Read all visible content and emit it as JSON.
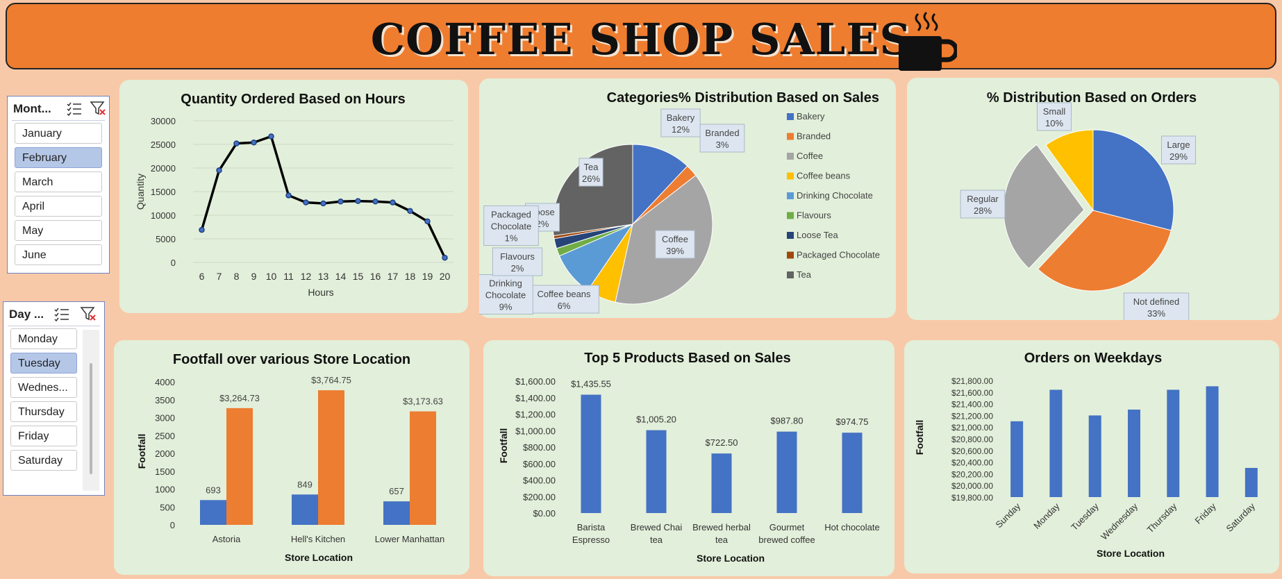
{
  "header": {
    "title": "COFFEE SHOP SALES"
  },
  "slicers": {
    "month": {
      "title": "Mont...",
      "items": [
        "January",
        "February",
        "March",
        "April",
        "May",
        "June"
      ],
      "selected": "February"
    },
    "day": {
      "title": "Day ...",
      "items": [
        "Monday",
        "Tuesday",
        "Wednes...",
        "Thursday",
        "Friday",
        "Saturday"
      ],
      "selected": "Tuesday"
    }
  },
  "chart_data": [
    {
      "type": "line",
      "title": "Quantity Ordered Based on Hours",
      "xlabel": "Hours",
      "ylabel": "Quantity",
      "x": [
        6,
        7,
        8,
        9,
        10,
        11,
        12,
        13,
        14,
        15,
        16,
        17,
        18,
        19,
        20
      ],
      "values": [
        6900,
        19500,
        25200,
        25400,
        26700,
        14200,
        12700,
        12500,
        12900,
        13000,
        12900,
        12700,
        10900,
        8700,
        1000
      ],
      "yticks": [
        0,
        5000,
        10000,
        15000,
        20000,
        25000,
        30000
      ],
      "ylim": [
        0,
        30000
      ],
      "color": "#000000",
      "grid": true
    },
    {
      "type": "pie",
      "title": "Categories%  Distribution Based on Sales",
      "slices": [
        {
          "name": "Bakery",
          "value": 12,
          "color": "#4472c4",
          "label": "12%"
        },
        {
          "name": "Branded",
          "value": 2.5,
          "color": "#ed7d31",
          "label": "3%"
        },
        {
          "name": "Coffee",
          "value": 39,
          "color": "#a5a5a5",
          "label": "39%"
        },
        {
          "name": "Coffee beans",
          "value": 6,
          "color": "#ffc000",
          "label": "6%"
        },
        {
          "name": "Drinking Chocolate",
          "value": 9,
          "color": "#5b9bd5",
          "label": "9%"
        },
        {
          "name": "Flavours",
          "value": 1.6,
          "color": "#70ad47",
          "label": "2%"
        },
        {
          "name": "Loose Tea",
          "value": 2,
          "color": "#264478",
          "label": "2%"
        },
        {
          "name": "Packaged Chocolate",
          "value": 0.6,
          "color": "#9e480e",
          "label": "1%"
        },
        {
          "name": "Tea",
          "value": 27.3,
          "color": "#636363",
          "label": "26%"
        }
      ],
      "legend": "right"
    },
    {
      "type": "pie",
      "title": "% Distribution Based on Orders",
      "slices": [
        {
          "name": "Large",
          "value": 29,
          "color": "#4472c4",
          "label": "29%"
        },
        {
          "name": "Not defined",
          "value": 33,
          "color": "#ed7d31",
          "label": "33%"
        },
        {
          "name": "Regular",
          "value": 28,
          "color": "#a5a5a5",
          "label": "28%"
        },
        {
          "name": "Small",
          "value": 10,
          "color": "#ffc000",
          "label": "10%"
        }
      ]
    },
    {
      "type": "bar",
      "title": "Footfall over various Store Location",
      "xlabel": "Store Location",
      "ylabel": "Footfall",
      "categories": [
        "Astoria",
        "Hell's Kitchen",
        "Lower Manhattan"
      ],
      "series": [
        {
          "values": [
            693,
            849,
            657
          ],
          "color": "#4472c4",
          "labels": [
            "693",
            "849",
            "657"
          ]
        },
        {
          "values": [
            3264.73,
            3764.75,
            3173.63
          ],
          "color": "#ed7d31",
          "labels": [
            "$3,264.73",
            "$3,764.75",
            "$3,173.63"
          ]
        }
      ],
      "yticks": [
        0,
        500,
        1000,
        1500,
        2000,
        2500,
        3000,
        3500,
        4000
      ],
      "ylim": [
        0,
        4000
      ]
    },
    {
      "type": "bar",
      "title": "Top 5 Products Based on Sales",
      "xlabel": "Store Location",
      "ylabel": "Footfall",
      "categories": [
        [
          "Barista",
          "Espresso"
        ],
        [
          "Brewed Chai",
          "tea"
        ],
        [
          "Brewed herbal",
          "tea"
        ],
        [
          "Gourmet",
          "brewed coffee"
        ],
        [
          "Hot chocolate"
        ]
      ],
      "values": [
        1435.55,
        1005.2,
        722.5,
        987.8,
        974.75
      ],
      "labels": [
        "$1,435.55",
        "$1,005.20",
        "$722.50",
        "$987.80",
        "$974.75"
      ],
      "ytick_labels": [
        "$0.00",
        "$200.00",
        "$400.00",
        "$600.00",
        "$800.00",
        "$1,000.00",
        "$1,200.00",
        "$1,400.00",
        "$1,600.00"
      ],
      "ylim": [
        0,
        1600
      ],
      "color": "#4472c4"
    },
    {
      "type": "bar",
      "title": "Orders on Weekdays",
      "xlabel": "Store Location",
      "ylabel": "Footfall",
      "categories": [
        "Sunday",
        "Monday",
        "Tuesday",
        "Wednesday",
        "Thursday",
        "Friday",
        "Saturday"
      ],
      "values": [
        21100,
        21640,
        21200,
        21300,
        21640,
        21700,
        20300
      ],
      "ytick_labels": [
        "$19,800.00",
        "$20,000.00",
        "$20,200.00",
        "$20,400.00",
        "$20,600.00",
        "$20,800.00",
        "$21,000.00",
        "$21,200.00",
        "$21,400.00",
        "$21,600.00",
        "$21,800.00"
      ],
      "ylim": [
        19800,
        21800
      ],
      "color": "#4472c4"
    }
  ]
}
